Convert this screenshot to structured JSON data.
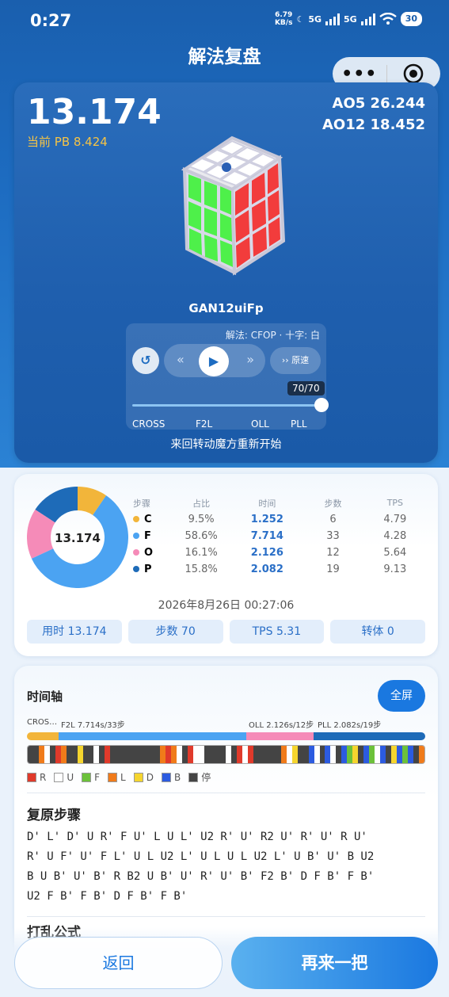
{
  "status_bar": {
    "time": "0:27",
    "net_speed_value": "6.79",
    "net_speed_unit": "KB/s",
    "sig1": "5G",
    "sig2": "5G",
    "battery": "30"
  },
  "header": {
    "title": "解法复盘"
  },
  "capsule": {
    "more_icon": "more-dots-icon",
    "close_icon": "target-circle-icon"
  },
  "hero": {
    "time": "13.174",
    "current_pb": "当前 PB 8.424",
    "ao5": "AO5 26.244",
    "ao12": "AO12 18.452",
    "device": "GAN12uiFp",
    "method": "解法: CFOP · 十字: 白",
    "speed": "›› 原速",
    "move_counter": "70/70",
    "progress": 1.0,
    "stages": [
      "CROSS",
      "F2L",
      "OLL",
      "PLL"
    ],
    "hint": "来回转动魔方重新开始"
  },
  "stats": {
    "center_time": "13.174",
    "headers": [
      "步骤",
      "占比",
      "时间",
      "步数",
      "TPS"
    ],
    "rows": [
      {
        "step": "C",
        "pct": "9.5%",
        "time": "1.252",
        "moves": "6",
        "tps": "4.79",
        "color": "#f2b53a"
      },
      {
        "step": "F",
        "pct": "58.6%",
        "time": "7.714",
        "moves": "33",
        "tps": "4.28",
        "color": "#4ba3f2"
      },
      {
        "step": "O",
        "pct": "16.1%",
        "time": "2.126",
        "moves": "12",
        "tps": "5.64",
        "color": "#f58bb8"
      },
      {
        "step": "P",
        "pct": "15.8%",
        "time": "2.082",
        "moves": "19",
        "tps": "9.13",
        "color": "#1e6bb8"
      }
    ],
    "date": "2026年8月26日 00:27:06",
    "chips": [
      "用时 13.174",
      "步数 70",
      "TPS 5.31",
      "转体 0"
    ]
  },
  "timeline": {
    "title": "时间轴",
    "fullscreen": "全屏",
    "phase_label_left1": "CROS…",
    "phase_label_left2": "F2L 7.714s/33步",
    "phase_label_right1": "OLL 2.126s/12步",
    "phase_label_right2": "PLL 2.082s/19步",
    "legend": [
      {
        "label": "R",
        "color": "#e03a2b"
      },
      {
        "label": "U",
        "color": "#ffffff"
      },
      {
        "label": "F",
        "color": "#6cc13a"
      },
      {
        "label": "L",
        "color": "#f07b1a"
      },
      {
        "label": "D",
        "color": "#f5d52e"
      },
      {
        "label": "B",
        "color": "#2c5be0"
      },
      {
        "label": "停",
        "color": "#444444"
      }
    ]
  },
  "solution": {
    "title": "复原步骤",
    "moves": "D' L' D' U R' F U' L U L' U2 R' U' R2 U' R' U' R U'\nR' U F' U' F L' U L U2 L' U L U L U2 L' U B' U' B U2\nB U B' U' B' R B2 U B' U' R' U' B' F2 B' D F B' F B'\nU2 F B' F B' D F B' F B'"
  },
  "scramble": {
    "title": "打乱公式"
  },
  "buttons": {
    "back": "返回",
    "again": "再来一把"
  },
  "chart_data": {
    "type": "pie",
    "categories": [
      "C",
      "F",
      "O",
      "P"
    ],
    "values": [
      9.5,
      58.6,
      16.1,
      15.8
    ],
    "title": "13.174"
  }
}
